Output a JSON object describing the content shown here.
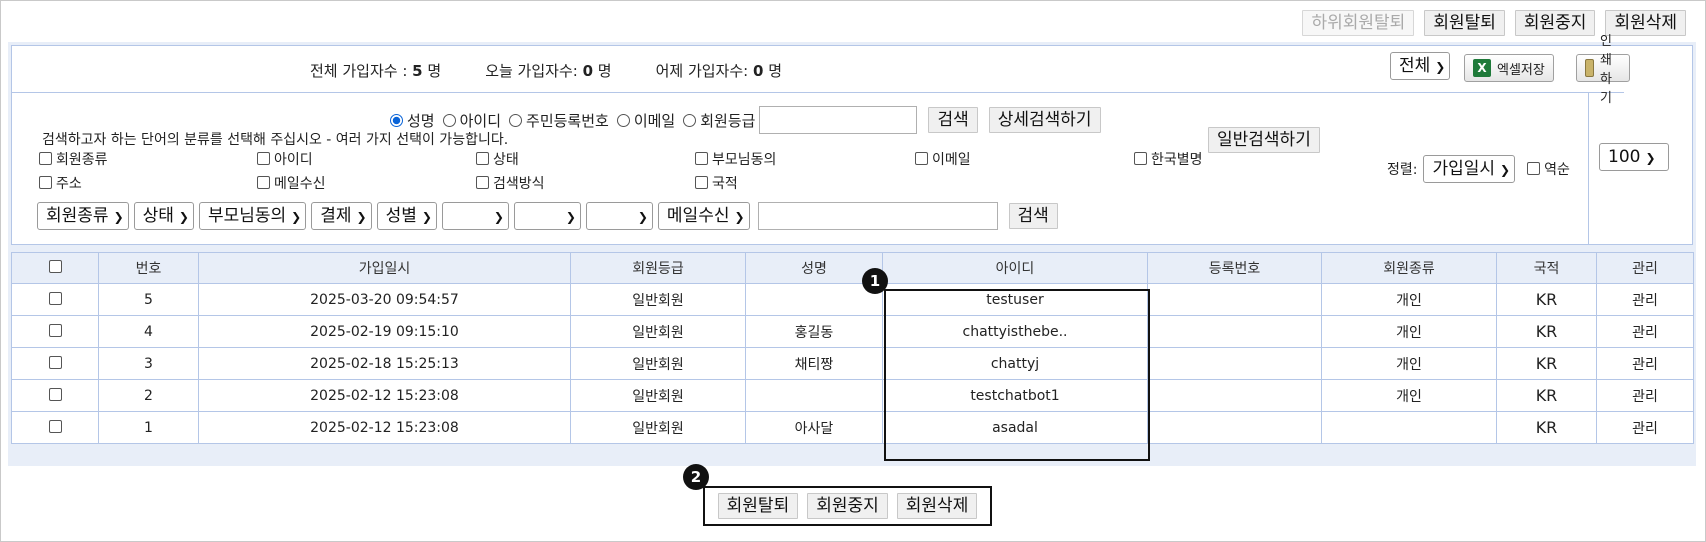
{
  "top_actions": [
    "하위회원탈퇴",
    "회원탈퇴",
    "회원중지",
    "회원삭제"
  ],
  "stats": {
    "total_label": "전체 가입자수 : ",
    "total_value": "5",
    "total_unit": " 명",
    "today_label": "오늘 가입자수: ",
    "today_value": "0",
    "today_unit": " 명",
    "yesterday_label": "어제 가입자수: ",
    "yesterday_value": "0",
    "yesterday_unit": " 명"
  },
  "scope_select": "전체",
  "excel_button": "엑셀저장",
  "print_button": "인쇄하기",
  "search": {
    "radios": [
      "성명",
      "아이디",
      "주민등록번호",
      "이메일",
      "회원등급"
    ],
    "selected_radio": "성명",
    "search_button": "검색",
    "detail_button": "상세검색하기",
    "general_button": "일반검색하기",
    "hint": "검색하고자 하는 단어의 분류를 선택해 주십시오 - 여러 가지 선택이 가능합니다.",
    "checkboxes_row1": [
      "회원종류",
      "아이디",
      "상태",
      "부모님동의",
      "이메일",
      "한국별명"
    ],
    "checkboxes_row2": [
      "주소",
      "메일수신",
      "검색방식",
      "국적"
    ],
    "sort_label": "정렬:",
    "sort_value": "가입일시",
    "reverse_label": "역순",
    "page_size": "100",
    "filter_selects": [
      "회원종류",
      "상태",
      "부모님동의",
      "결제",
      "성별",
      "",
      "",
      "",
      "메일수신"
    ],
    "filter_search_button": "검색"
  },
  "table": {
    "headers": [
      "번호",
      "가입일시",
      "회원등급",
      "성명",
      "아이디",
      "등록번호",
      "회원종류",
      "국적",
      "관리"
    ],
    "rows": [
      {
        "no": "5",
        "date": "2025-03-20 09:54:57",
        "grade": "일반회원",
        "name": "",
        "id": "testuser",
        "reg": "",
        "type": "개인",
        "country": "KR",
        "manage": "관리"
      },
      {
        "no": "4",
        "date": "2025-02-19 09:15:10",
        "grade": "일반회원",
        "name": "홍길동",
        "id": "chattyisthebe..",
        "reg": "",
        "type": "개인",
        "country": "KR",
        "manage": "관리"
      },
      {
        "no": "3",
        "date": "2025-02-18 15:25:13",
        "grade": "일반회원",
        "name": "채티짱",
        "id": "chattyj",
        "reg": "",
        "type": "개인",
        "country": "KR",
        "manage": "관리"
      },
      {
        "no": "2",
        "date": "2025-02-12 15:23:08",
        "grade": "일반회원",
        "name": "",
        "id": "testchatbot1",
        "reg": "",
        "type": "개인",
        "country": "KR",
        "manage": "관리"
      },
      {
        "no": "1",
        "date": "2025-02-12 15:23:08",
        "grade": "일반회원",
        "name": "아사달",
        "id": "asadal",
        "reg": "",
        "type": "",
        "country": "KR",
        "manage": "관리"
      }
    ]
  },
  "bottom_actions": [
    "회원탈퇴",
    "회원중지",
    "회원삭제"
  ],
  "badges": [
    "1",
    "2"
  ]
}
